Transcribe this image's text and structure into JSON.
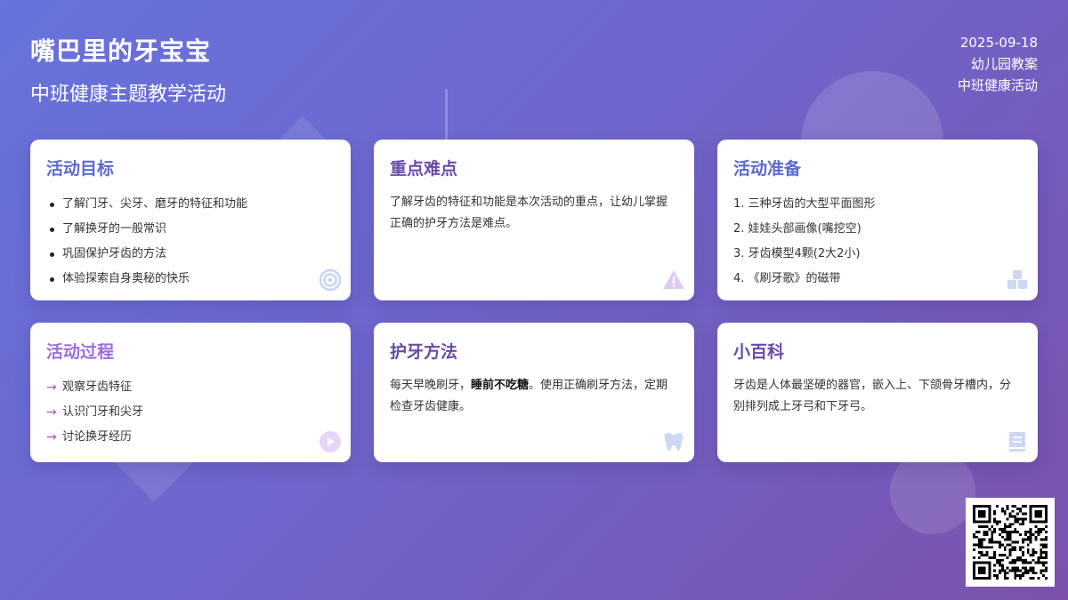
{
  "header": {
    "title": "嘴巴里的牙宝宝",
    "subtitle": "中班健康主题教学活动"
  },
  "meta": {
    "date": "2025-09-18",
    "type": "幼儿园教案",
    "category": "中班健康活动"
  },
  "cards": {
    "goals": {
      "title": "活动目标",
      "items": [
        "了解门牙、尖牙、磨牙的特征和功能",
        "了解换牙的一般常识",
        "巩固保护牙齿的方法",
        "体验探索自身奥秘的快乐"
      ],
      "icon": "target-icon"
    },
    "focus": {
      "title": "重点难点",
      "text": "了解牙齿的特征和功能是本次活动的重点，让幼儿掌握正确的护牙方法是难点。",
      "icon": "warning-icon"
    },
    "prep": {
      "title": "活动准备",
      "items": [
        "1. 三种牙齿的大型平面图形",
        "2. 娃娃头部画像(嘴挖空)",
        "3. 牙齿模型4颗(2大2小)",
        "4. 《刷牙歌》的磁带"
      ],
      "icon": "cubes-icon"
    },
    "process": {
      "title": "活动过程",
      "items": [
        "观察牙齿特征",
        "认识门牙和尖牙",
        "讨论换牙经历"
      ],
      "icon": "play-icon"
    },
    "care": {
      "title": "护牙方法",
      "text_before": "每天早晚刷牙，",
      "text_bold": "睡前不吃糖",
      "text_after": "。使用正确刷牙方法，定期检查牙齿健康。",
      "icon": "tooth-icon"
    },
    "facts": {
      "title": "小百科",
      "text": "牙齿是人体最坚硬的器官，嵌入上、下颌骨牙槽内，分别排列成上牙弓和下牙弓。",
      "icon": "book-icon"
    }
  },
  "qr": {
    "icon": "qr-code-icon"
  }
}
